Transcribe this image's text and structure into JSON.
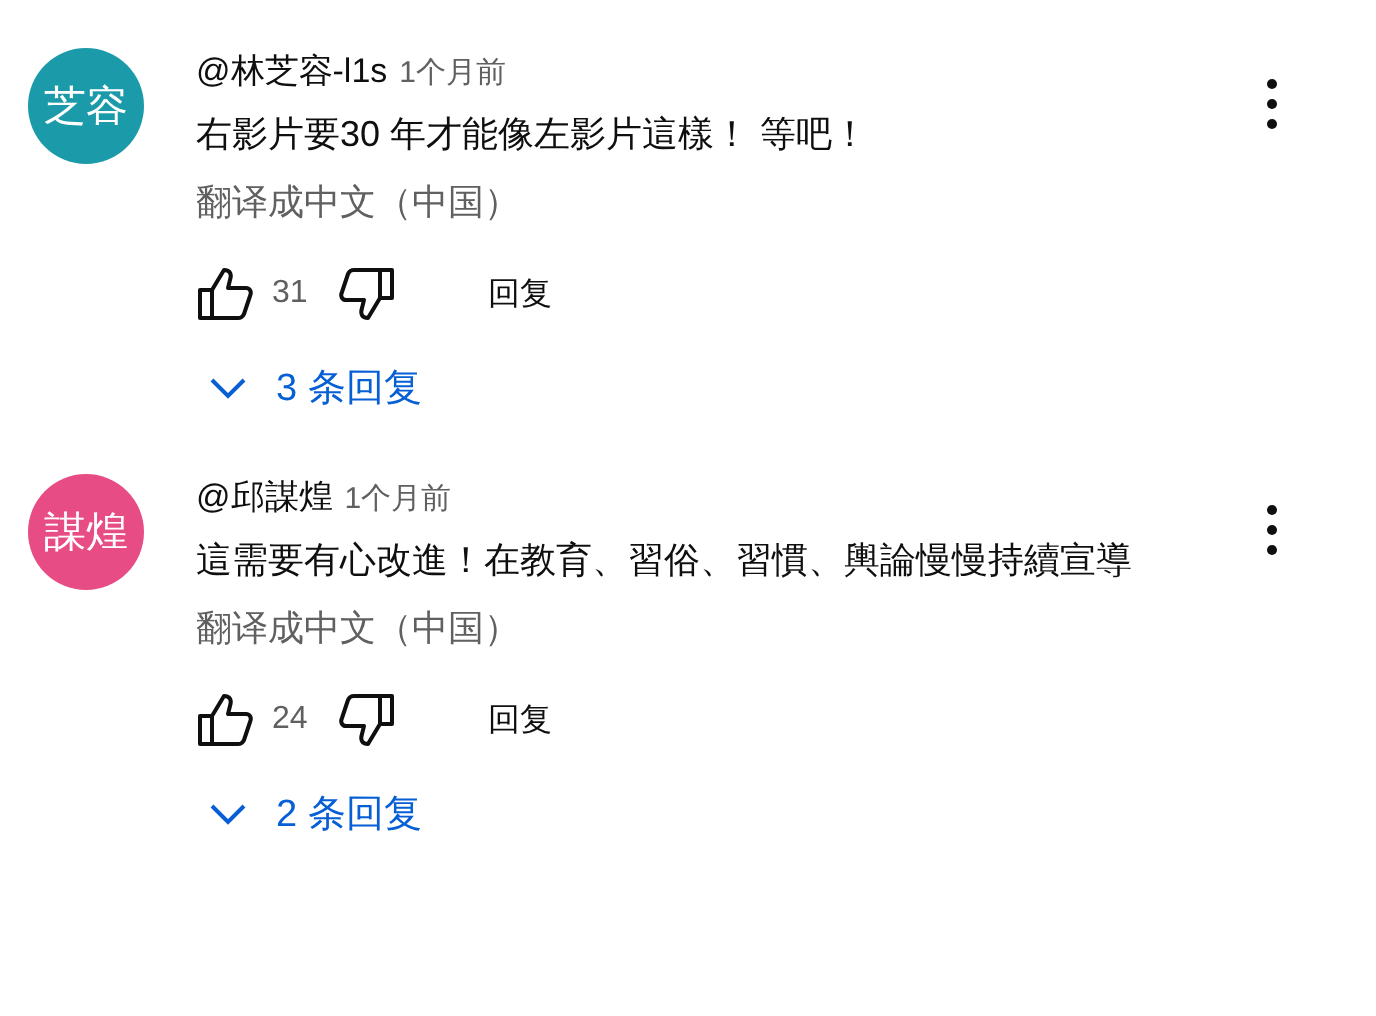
{
  "comments": [
    {
      "avatar": {
        "text": "芝容",
        "color": "#1b9aa9"
      },
      "author": "@林芝容-l1s",
      "time": "1个月前",
      "text": "右影片要30 年才能像左影片這樣！ 等吧！",
      "translate": "翻译成中文（中国）",
      "likes": "31",
      "reply": "回复",
      "replies": "3 条回复"
    },
    {
      "avatar": {
        "text": "謀煌",
        "color": "#e84c85"
      },
      "author": "@邱謀煌",
      "time": "1个月前",
      "text": "這需要有心改進！在教育、習俗、習慣、輿論慢慢持續宣導",
      "translate": "翻译成中文（中国）",
      "likes": "24",
      "reply": "回复",
      "replies": "2 条回复"
    }
  ]
}
